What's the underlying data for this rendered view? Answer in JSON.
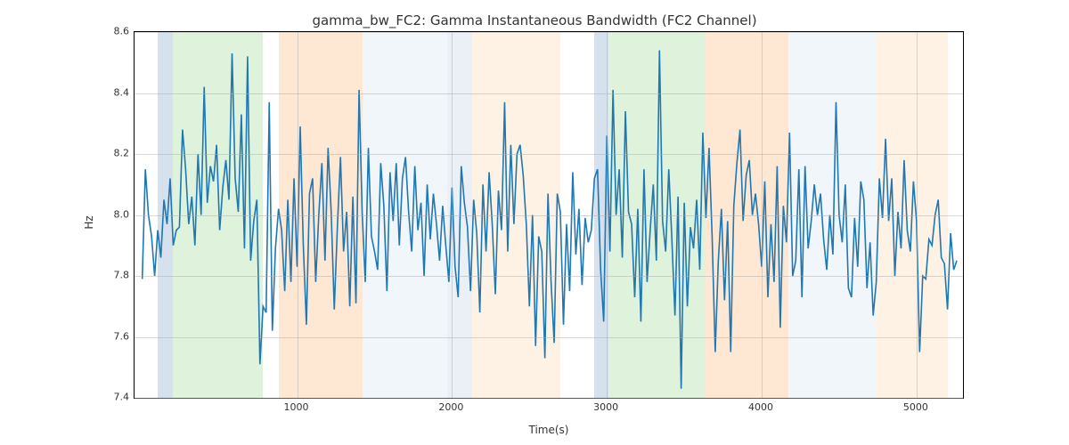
{
  "chart_data": {
    "type": "line",
    "title": "gamma_bw_FC2: Gamma Instantaneous Bandwidth (FC2 Channel)",
    "xlabel": "Time(s)",
    "ylabel": "Hz",
    "xlim": [
      -50,
      5300
    ],
    "ylim": [
      7.4,
      8.6
    ],
    "xticks": [
      1000,
      2000,
      3000,
      4000,
      5000
    ],
    "yticks": [
      7.4,
      7.6,
      7.8,
      8.0,
      8.2,
      8.4,
      8.6
    ],
    "bands": [
      {
        "x0": 100,
        "x1": 200,
        "color": "#88aacc"
      },
      {
        "x0": 200,
        "x1": 780,
        "color": "#a1d99b"
      },
      {
        "x0": 880,
        "x1": 1420,
        "color": "#fdbe85"
      },
      {
        "x0": 1420,
        "x1": 1970,
        "color": "#d6e4f0"
      },
      {
        "x0": 1970,
        "x1": 2130,
        "color": "#88aacc",
        "alpha": 0.18
      },
      {
        "x0": 2130,
        "x1": 2700,
        "color": "#fdd9b5"
      },
      {
        "x0": 2920,
        "x1": 3010,
        "color": "#88aacc"
      },
      {
        "x0": 3010,
        "x1": 3640,
        "color": "#a1d99b"
      },
      {
        "x0": 3640,
        "x1": 4170,
        "color": "#fdbe85"
      },
      {
        "x0": 4170,
        "x1": 4740,
        "color": "#d6e4f0"
      },
      {
        "x0": 4740,
        "x1": 5200,
        "color": "#fdd9b5"
      }
    ],
    "series": [
      {
        "name": "gamma_bw_FC2",
        "color": "#1f77b4",
        "x": [
          0,
          20,
          40,
          60,
          80,
          100,
          120,
          140,
          160,
          180,
          200,
          220,
          240,
          260,
          280,
          300,
          320,
          340,
          360,
          380,
          400,
          420,
          440,
          460,
          480,
          500,
          520,
          540,
          560,
          580,
          600,
          620,
          640,
          660,
          680,
          700,
          720,
          740,
          760,
          780,
          800,
          820,
          840,
          860,
          880,
          900,
          920,
          940,
          960,
          980,
          1000,
          1020,
          1040,
          1060,
          1080,
          1100,
          1120,
          1140,
          1160,
          1180,
          1200,
          1220,
          1240,
          1260,
          1280,
          1300,
          1320,
          1340,
          1360,
          1380,
          1400,
          1420,
          1440,
          1460,
          1480,
          1500,
          1520,
          1540,
          1560,
          1580,
          1600,
          1620,
          1640,
          1660,
          1680,
          1700,
          1720,
          1740,
          1760,
          1780,
          1800,
          1820,
          1840,
          1860,
          1880,
          1900,
          1920,
          1940,
          1960,
          1980,
          2000,
          2020,
          2040,
          2060,
          2080,
          2100,
          2120,
          2140,
          2160,
          2180,
          2200,
          2220,
          2240,
          2260,
          2280,
          2300,
          2320,
          2340,
          2360,
          2380,
          2400,
          2420,
          2440,
          2460,
          2480,
          2500,
          2520,
          2540,
          2560,
          2580,
          2600,
          2620,
          2640,
          2660,
          2680,
          2700,
          2720,
          2740,
          2760,
          2780,
          2800,
          2820,
          2840,
          2860,
          2880,
          2900,
          2920,
          2940,
          2960,
          2980,
          3000,
          3020,
          3040,
          3060,
          3080,
          3100,
          3120,
          3140,
          3160,
          3180,
          3200,
          3220,
          3240,
          3260,
          3280,
          3300,
          3320,
          3340,
          3360,
          3380,
          3400,
          3420,
          3440,
          3460,
          3480,
          3500,
          3520,
          3540,
          3560,
          3580,
          3600,
          3620,
          3640,
          3660,
          3680,
          3700,
          3720,
          3740,
          3760,
          3780,
          3800,
          3820,
          3840,
          3860,
          3880,
          3900,
          3920,
          3940,
          3960,
          3980,
          4000,
          4020,
          4040,
          4060,
          4080,
          4100,
          4120,
          4140,
          4160,
          4180,
          4200,
          4220,
          4240,
          4260,
          4280,
          4300,
          4320,
          4340,
          4360,
          4380,
          4400,
          4420,
          4440,
          4460,
          4480,
          4500,
          4520,
          4540,
          4560,
          4580,
          4600,
          4620,
          4640,
          4660,
          4680,
          4700,
          4720,
          4740,
          4760,
          4780,
          4800,
          4820,
          4840,
          4860,
          4880,
          4900,
          4920,
          4940,
          4960,
          4980,
          5000,
          5020,
          5040,
          5060,
          5080,
          5100,
          5120,
          5140,
          5160,
          5180,
          5200,
          5220,
          5240,
          5260
        ],
        "y": [
          7.79,
          8.15,
          8.0,
          7.93,
          7.8,
          7.95,
          7.86,
          8.05,
          7.97,
          8.12,
          7.9,
          7.95,
          7.96,
          8.28,
          8.15,
          7.97,
          8.06,
          7.9,
          8.2,
          8.0,
          8.42,
          8.04,
          8.16,
          8.11,
          8.23,
          7.95,
          8.09,
          8.18,
          8.05,
          8.53,
          8.12,
          8.01,
          8.33,
          7.89,
          8.52,
          7.85,
          7.98,
          8.05,
          7.51,
          7.7,
          7.68,
          8.37,
          7.62,
          7.89,
          8.02,
          7.95,
          7.75,
          8.05,
          7.78,
          8.12,
          7.83,
          8.29,
          7.9,
          7.64,
          8.07,
          8.12,
          7.78,
          8.0,
          8.17,
          7.85,
          8.22,
          8.01,
          7.69,
          7.96,
          8.19,
          7.88,
          8.01,
          7.7,
          8.06,
          7.71,
          8.41,
          8.01,
          7.78,
          8.22,
          7.93,
          7.88,
          7.82,
          8.17,
          8.03,
          7.75,
          8.14,
          7.98,
          8.17,
          7.9,
          8.12,
          8.19,
          8.01,
          7.88,
          8.16,
          7.95,
          8.04,
          7.8,
          8.1,
          7.92,
          8.07,
          7.97,
          7.85,
          8.03,
          7.9,
          7.78,
          8.09,
          7.83,
          7.73,
          8.16,
          8.04,
          7.96,
          7.75,
          8.05,
          7.94,
          7.68,
          8.1,
          7.88,
          8.14,
          7.97,
          7.74,
          8.08,
          7.95,
          8.37,
          7.88,
          8.23,
          7.97,
          8.2,
          8.23,
          8.13,
          7.97,
          7.7,
          8.0,
          7.57,
          7.93,
          7.88,
          7.53,
          8.07,
          7.78,
          7.58,
          8.07,
          8.01,
          7.64,
          7.97,
          7.75,
          8.14,
          7.87,
          8.02,
          7.77,
          7.99,
          7.91,
          7.95,
          8.12,
          8.15,
          7.82,
          7.65,
          8.26,
          7.88,
          8.41,
          8.0,
          8.15,
          7.86,
          8.34,
          8.01,
          7.97,
          7.73,
          8.02,
          7.65,
          8.15,
          7.78,
          7.95,
          8.1,
          7.85,
          8.54,
          7.98,
          7.88,
          8.15,
          7.92,
          7.67,
          8.06,
          7.43,
          8.04,
          7.7,
          7.96,
          7.89,
          8.05,
          7.82,
          8.27,
          7.99,
          8.22,
          7.93,
          7.55,
          7.85,
          8.02,
          7.72,
          7.98,
          7.55,
          8.03,
          8.17,
          8.28,
          7.98,
          8.13,
          8.18,
          8.0,
          8.07,
          7.97,
          7.83,
          8.11,
          7.73,
          7.97,
          7.78,
          8.16,
          7.63,
          8.03,
          7.91,
          8.27,
          7.8,
          7.85,
          8.15,
          7.73,
          8.16,
          7.89,
          7.98,
          8.1,
          8.0,
          8.07,
          7.92,
          7.82,
          8.0,
          7.87,
          8.37,
          8.0,
          7.91,
          8.1,
          7.76,
          7.73,
          7.99,
          7.83,
          8.11,
          8.05,
          7.76,
          7.91,
          7.67,
          7.78,
          8.12,
          7.99,
          8.25,
          7.98,
          8.12,
          7.8,
          8.01,
          7.89,
          8.18,
          7.95,
          7.88,
          8.11,
          7.98,
          7.55,
          7.8,
          7.79,
          7.92,
          7.9,
          8.0,
          8.05,
          7.86,
          7.84,
          7.69,
          7.94,
          7.82,
          7.85
        ]
      }
    ]
  }
}
